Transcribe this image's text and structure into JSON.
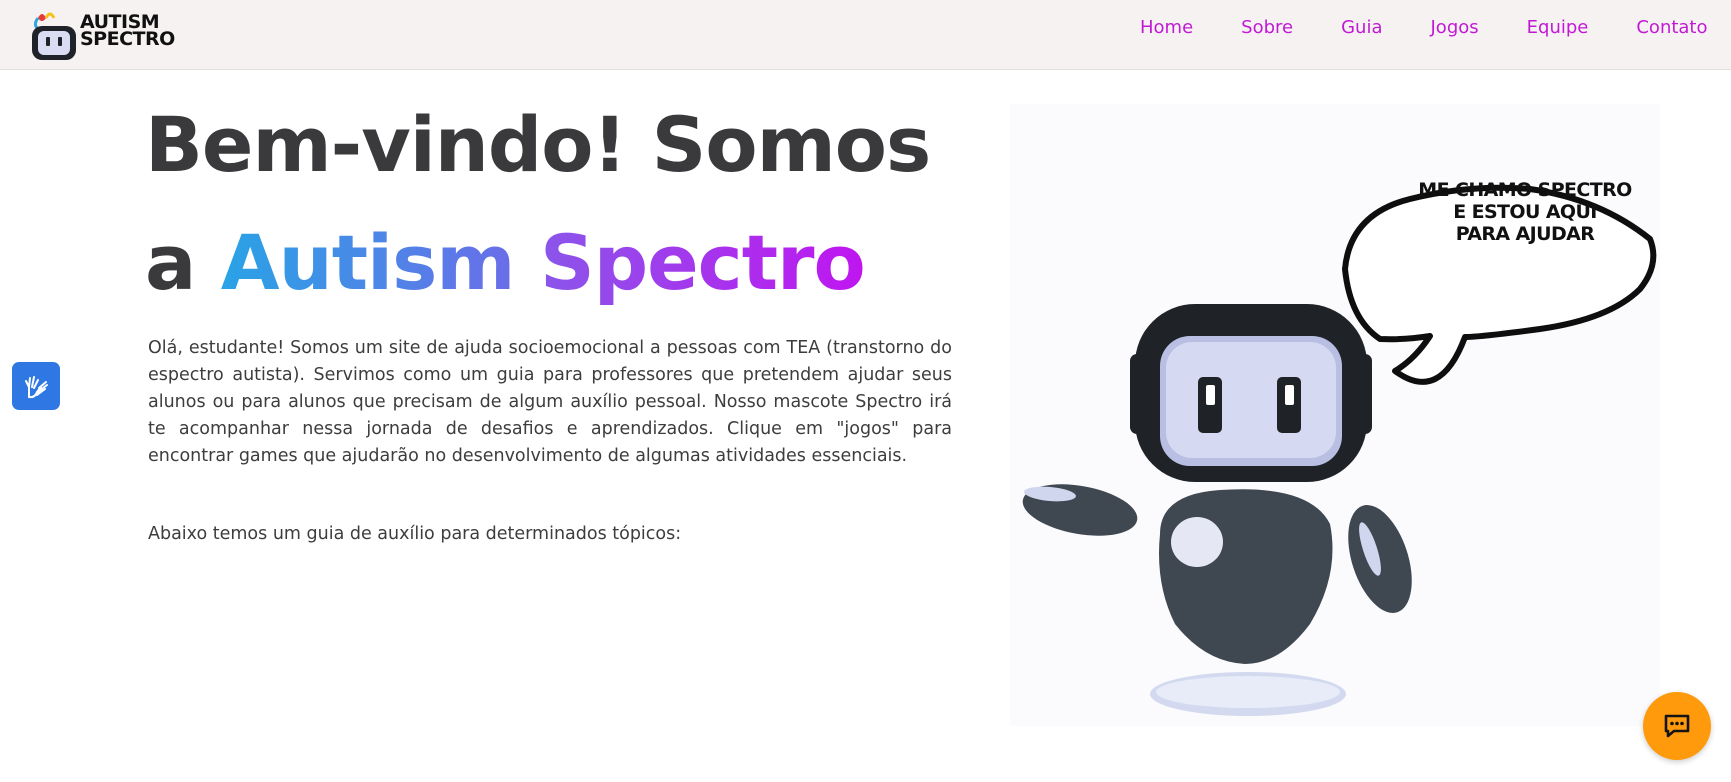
{
  "header": {
    "logo_text_line1": "AUTISM",
    "logo_text_line2": "SPECTRO",
    "nav": [
      {
        "label": "Home"
      },
      {
        "label": "Sobre"
      },
      {
        "label": "Guia"
      },
      {
        "label": "Jogos"
      },
      {
        "label": "Equipe"
      },
      {
        "label": "Contato"
      }
    ]
  },
  "hero": {
    "title_line1": "Bem-vindo! Somos",
    "title_prefix": "a",
    "title_brand_1": "Autism",
    "title_brand_2": "Spectro",
    "intro": "Olá, estudante! Somos um site de ajuda socioemocional a pessoas com TEA (transtorno do espectro autista). Servimos como um guia para professores que pretendem ajudar seus alunos ou para alunos que precisam de algum auxílio pessoal. Nosso mascote Spectro irá te acompanhar nessa jornada de desafios e aprendizados. Clique em \"jogos\" para encontrar games que ajudarão no desenvolvimento de algumas atividades essenciais.",
    "guide_note": "Abaixo temos um guia de auxílio para determinados tópicos:"
  },
  "mascot": {
    "speech_line1": "ME CHAMO SPECTRO",
    "speech_line2": "E ESTOU AQUI",
    "speech_line3": "PARA AJUDAR"
  },
  "widgets": {
    "accessibility_icon": "sign-language-hands-icon",
    "chat_icon": "chat-bubble-icon"
  },
  "colors": {
    "nav_link": "#c11ad4",
    "gradient_start": "#29a3e6",
    "gradient_end": "#c015f0",
    "accessibility_button": "#2f78e3",
    "chat_button": "#fe9a0b",
    "robot_dark": "#3f4750"
  }
}
